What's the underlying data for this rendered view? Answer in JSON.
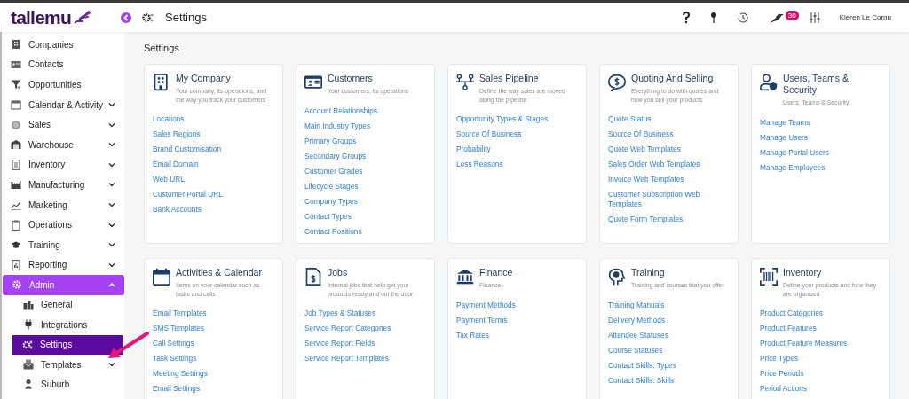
{
  "header": {
    "logo": "tallemu",
    "page_title": "Settings",
    "notification_count": "30",
    "user_name": "Kieren Le Cornu"
  },
  "sidebar": {
    "items": [
      {
        "label": "Companies",
        "expandable": false,
        "selected": false
      },
      {
        "label": "Contacts",
        "expandable": false,
        "selected": false
      },
      {
        "label": "Opportunities",
        "expandable": false,
        "selected": false
      },
      {
        "label": "Calendar & Activity",
        "expandable": true,
        "expanded": false,
        "selected": false
      },
      {
        "label": "Sales",
        "expandable": true,
        "expanded": false,
        "selected": false
      },
      {
        "label": "Warehouse",
        "expandable": true,
        "expanded": false,
        "selected": false
      },
      {
        "label": "Inventory",
        "expandable": true,
        "expanded": false,
        "selected": false
      },
      {
        "label": "Manufacturing",
        "expandable": true,
        "expanded": false,
        "selected": false
      },
      {
        "label": "Marketing",
        "expandable": true,
        "expanded": false,
        "selected": false
      },
      {
        "label": "Operations",
        "expandable": true,
        "expanded": false,
        "selected": false
      },
      {
        "label": "Training",
        "expandable": true,
        "expanded": false,
        "selected": false
      },
      {
        "label": "Reporting",
        "expandable": true,
        "expanded": false,
        "selected": false
      },
      {
        "label": "Admin",
        "expandable": true,
        "expanded": true,
        "selected": true,
        "children": [
          {
            "label": "General",
            "expandable": false,
            "selected": false
          },
          {
            "label": "Integrations",
            "expandable": false,
            "selected": false
          },
          {
            "label": "Settings",
            "expandable": false,
            "selected": true
          },
          {
            "label": "Templates",
            "expandable": true,
            "expanded": false,
            "selected": false
          },
          {
            "label": "Suburb",
            "expandable": false,
            "selected": false
          }
        ]
      }
    ]
  },
  "content": {
    "heading": "Settings",
    "cards": [
      {
        "title": "My Company",
        "description": "Your company, its operations, and the way you track your customers",
        "links": [
          "Locations",
          "Sales Regions",
          "Brand Customisation",
          "Email Domain",
          "Web URL",
          "Customer Portal URL",
          "Bank Accounts"
        ]
      },
      {
        "title": "Customers",
        "description": "Your customers, its operations",
        "links": [
          "Account Relationships",
          "Main Industry Types",
          "Primary Groups",
          "Secondary Groups",
          "Customer Grades",
          "Lifecycle Stages",
          "Company Types",
          "Contact Types",
          "Contact Positions"
        ]
      },
      {
        "title": "Sales Pipeline",
        "description": "Define the way sales are moved along the pipeline",
        "links": [
          "Opportunity Types & Stages",
          "Source Of Business",
          "Probability",
          "Loss Reasons"
        ]
      },
      {
        "title": "Quoting And Selling",
        "description": "Everything to do with quotes and how you sell your products",
        "links": [
          "Quote Status",
          "Source Of Business",
          "Quote Web Templates",
          "Sales Order Web Templates",
          "Invoice Web Templates",
          "Customer Subscription Web Templates",
          "Quote Form Templates"
        ]
      },
      {
        "title": "Users, Teams & Security",
        "description": "Users, Teams & Security",
        "links": [
          "Manage Teams",
          "Manage Users",
          "Manage Portal Users",
          "Manage Employees"
        ]
      },
      {
        "title": "Activities & Calendar",
        "description": "Items on your calendar such as tasks and calls",
        "links": [
          "Email Templates",
          "SMS Templates",
          "Call Settings",
          "Task Settings",
          "Meeting Settings",
          "Email Settings"
        ]
      },
      {
        "title": "Jobs",
        "description": "Internal jobs that help get your products ready and out the door",
        "links": [
          "Job Types & Statuses",
          "Service Report Categories",
          "Service Report Fields",
          "Service Report Templates"
        ]
      },
      {
        "title": "Finance",
        "description": "Finance",
        "links": [
          "Payment Methods",
          "Payment Terms",
          "Tax Rates"
        ]
      },
      {
        "title": "Training",
        "description": "Training and courses that you offer",
        "links": [
          "Training Manuals",
          "Delivery Methods",
          "Attendee Statuses",
          "Course Statuses",
          "Contact Skills: Types",
          "Contact Skills: Skills"
        ]
      },
      {
        "title": "Inventory",
        "description": "Define your products and how they are organised",
        "links": [
          "Product Categories",
          "Product Features",
          "Product Feature Measures",
          "Price Types",
          "Price Periods",
          "Period Actions"
        ]
      }
    ]
  }
}
